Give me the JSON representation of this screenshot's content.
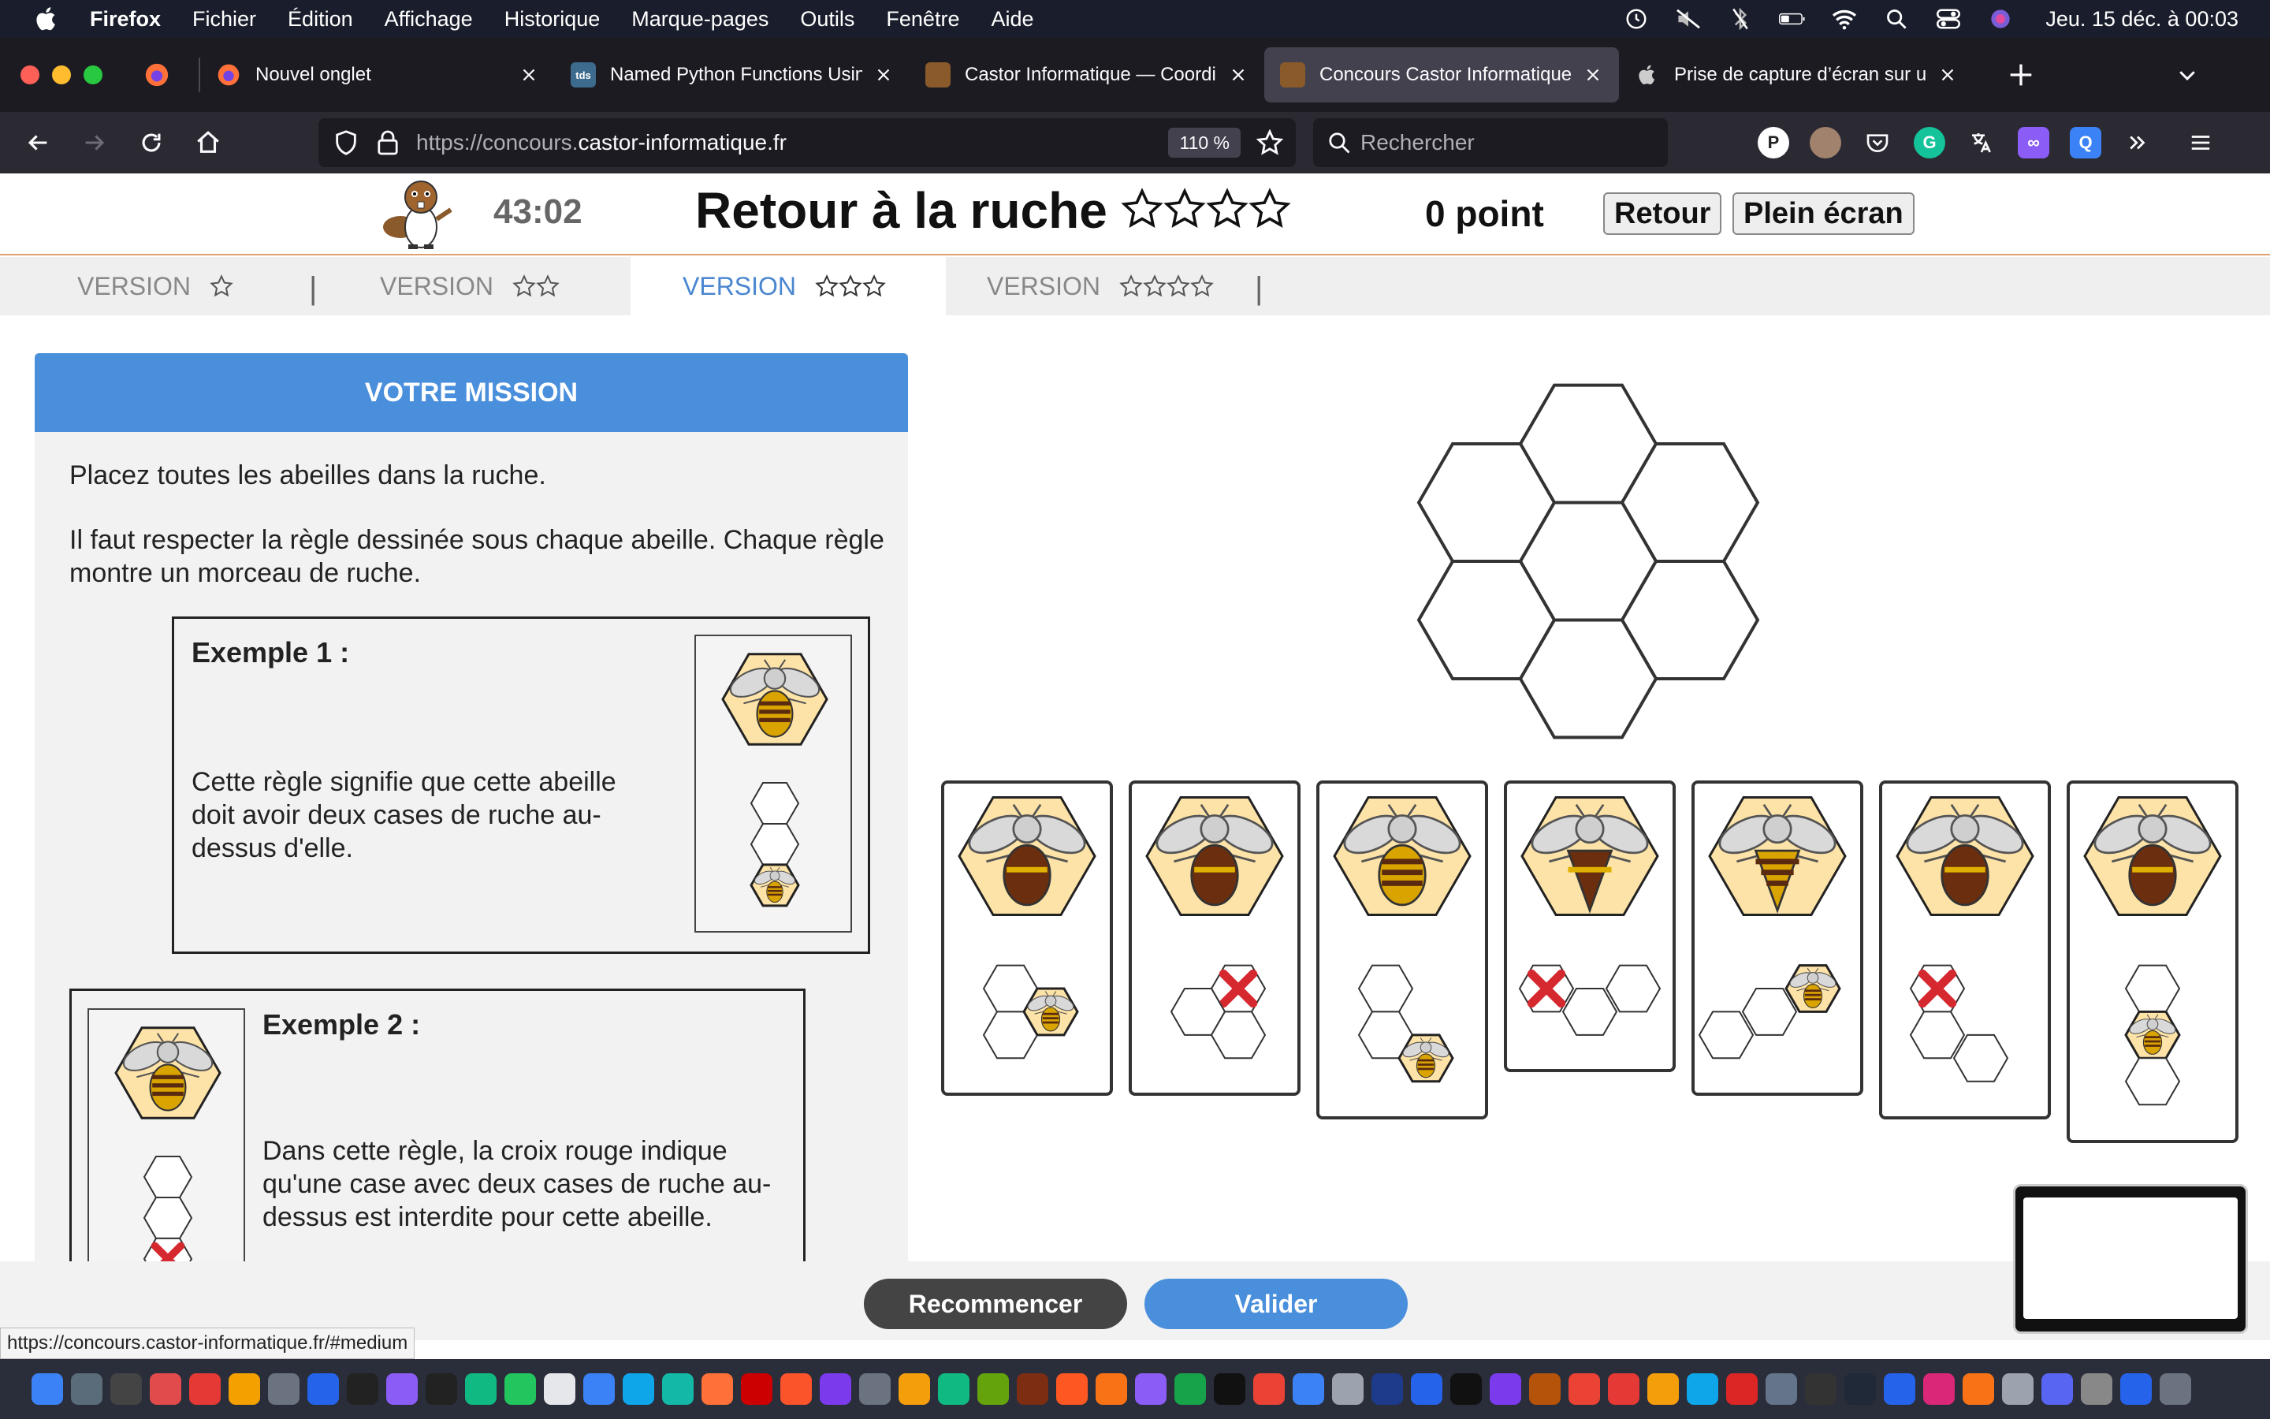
{
  "menubar": {
    "app_name": "Firefox",
    "items": [
      "Fichier",
      "Édition",
      "Affichage",
      "Historique",
      "Marque-pages",
      "Outils",
      "Fenêtre",
      "Aide"
    ],
    "clock": "Jeu. 15 déc. à  00:03"
  },
  "tabs": [
    {
      "title": "Nouvel onglet",
      "icon": "firefox-icon",
      "active": false
    },
    {
      "title": "Named Python Functions Using",
      "icon": "tds-icon",
      "active": false
    },
    {
      "title": "Castor Informatique — Coordina",
      "icon": "castor-icon",
      "active": false
    },
    {
      "title": "Concours Castor Informatique –",
      "icon": "castor-icon",
      "active": true
    },
    {
      "title": "Prise de capture d’écran sur un",
      "icon": "apple-icon",
      "active": false
    }
  ],
  "toolbar": {
    "url_prefix": "https://concours.",
    "url_domain": "castor-informatique.fr",
    "zoom": "110 %",
    "search_placeholder": "Rechercher"
  },
  "task": {
    "timer": "43:02",
    "title": "Retour à la ruche",
    "score": "0 point",
    "back_label": "Retour",
    "fullscreen_label": "Plein écran",
    "title_star_count": 4
  },
  "versions": [
    {
      "label": "VERSION",
      "stars": 1,
      "active": false
    },
    {
      "label": "VERSION",
      "stars": 2,
      "active": false
    },
    {
      "label": "VERSION",
      "stars": 3,
      "active": true
    },
    {
      "label": "VERSION",
      "stars": 4,
      "active": false
    }
  ],
  "mission": {
    "heading": "VOTRE MISSION",
    "intro": "Placez toutes les abeilles dans la ruche.",
    "rule": "Il faut respecter la règle dessinée sous chaque abeille. Chaque règle montre un morceau de ruche.",
    "example1_title": "Exemple 1 :",
    "example1_text": "Cette règle signifie que cette abeille doit avoir deux cases de ruche au-dessus d'elle.",
    "example2_title": "Exemple 2 :",
    "example2_text": "Dans cette règle, la croix rouge indique qu'une case avec deux cases de ruche au-dessus est interdite pour cette abeille."
  },
  "buttons": {
    "restart": "Recommencer",
    "validate": "Valider"
  },
  "status_url": "https://concours.castor-informatique.fr/#medium",
  "colors": {
    "mission_header": "#4a8fdc",
    "validate_button": "#4a8fdc",
    "restart_button": "#444444",
    "hex_fill": "#fde3a7",
    "cross_red": "#d6282f"
  }
}
